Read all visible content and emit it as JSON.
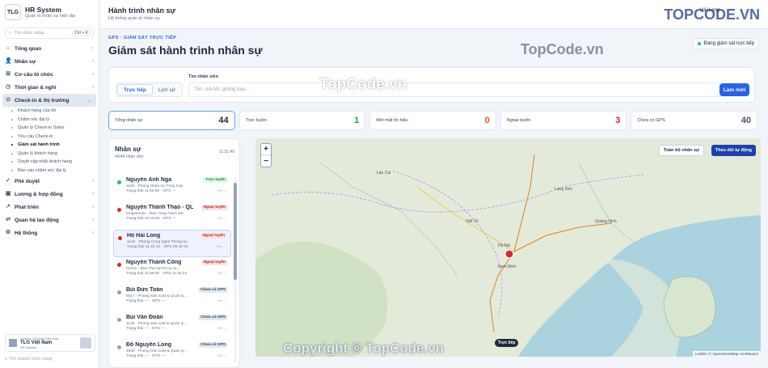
{
  "brand": {
    "logo": "TLG",
    "name": "HR System",
    "sub": "Quản trị nhân sự hiện đại"
  },
  "sidebar": {
    "search_placeholder": "Tìm chức năng...",
    "search_shortcut": "Ctrl + K",
    "items": [
      {
        "label": "Tổng quan",
        "icon": "home-icon"
      },
      {
        "label": "Nhân sự",
        "icon": "users-icon"
      },
      {
        "label": "Cơ cấu tổ chức",
        "icon": "org-icon"
      },
      {
        "label": "Thời gian & nghỉ",
        "icon": "clock-icon"
      },
      {
        "label": "Check-in & thị trường",
        "icon": "pin-icon",
        "expanded": true
      }
    ],
    "subitems": [
      "Khách hàng của tôi",
      "Chăm sóc đại lý",
      "Quản lý Check-in Sales",
      "Yêu cầu Check-in",
      "Giám sát hành trình",
      "Quản lý khách hàng",
      "Duyệt cập nhật khách hàng",
      "Báo cáo chăm sóc đại lý"
    ],
    "active_sub": "Giám sát hành trình",
    "items_after": [
      {
        "label": "Phê duyệt",
        "icon": "check-icon"
      },
      {
        "label": "Lương & hợp đồng",
        "icon": "wallet-icon"
      },
      {
        "label": "Phát triển",
        "icon": "growth-icon"
      },
      {
        "label": "Quan hệ lao động",
        "icon": "handshake-icon"
      },
      {
        "label": "Hệ thống",
        "icon": "gear-icon"
      }
    ],
    "company": {
      "line1": "Công ty Cổ phần Sản xuất",
      "line2": "TLG Việt Nam",
      "line3": "HR System"
    },
    "bottom_search": "Tìm nhanh chức năng"
  },
  "topbar": {
    "title": "Hành trình nhân sự",
    "subtitle": "Hệ thống quản trị nhân sự",
    "user": "Hải Long"
  },
  "page": {
    "eyebrow": "GPS · GIÁM SÁT TRỰC TIẾP",
    "title": "Giám sát hành trình nhân sự",
    "live_status": "Đang giám sát trực tiếp"
  },
  "filter": {
    "tabs": [
      "Trực tiếp",
      "Lịch sử"
    ],
    "active_tab": "Trực tiếp",
    "search_label": "Tìm nhân viên",
    "search_placeholder": "Tên, mã NV, phòng ban...",
    "refresh_label": "Làm mới"
  },
  "stats": [
    {
      "label": "Tổng nhân sự",
      "value": "44",
      "color": "#1e293b"
    },
    {
      "label": "Trực tuyến",
      "value": "1",
      "color": "#16a34a"
    },
    {
      "label": "Mới mất tín hiệu",
      "value": "0",
      "color": "#ea580c"
    },
    {
      "label": "Ngoại tuyến",
      "value": "3",
      "color": "#dc2626"
    },
    {
      "label": "Chưa có GPS",
      "value": "40",
      "color": "#475569"
    }
  ],
  "list": {
    "title": "Nhân sự",
    "count": "44/44 nhân viên",
    "time": "11:51:40",
    "employees": [
      {
        "name": "Nguyễn Anh Nga",
        "meta": "1156 · Phòng Nhân sự Tổng hợp",
        "status_line": "Trạng thái 11:50:59 · GPS —",
        "badge": "Trực tuyến",
        "status": "online",
        "src": "Pin —"
      },
      {
        "name": "Nguyễn Thành Thạo - QL",
        "meta": "tongiamdoc · Ban Tổng Giám đốc",
        "status_line": "Trạng thái 10:16:26 · GPS —",
        "badge": "Ngoại tuyến",
        "status": "offline",
        "src": "Pin —"
      },
      {
        "name": "Hồ Hải Long",
        "meta": "1142 · Phòng Công nghệ Thông tin",
        "status_line": "Trạng thái 11:42:12 · GPS 09:40:16",
        "badge": "Ngoại tuyến",
        "status": "offline",
        "src": "Pin —"
      },
      {
        "name": "Nguyễn Thành Công",
        "meta": "01001 · Ban Thư ký/Trợ lý ca...",
        "status_line": "Trạng thái 11:55:02 · GPS 11:34:44",
        "badge": "Ngoại tuyến",
        "status": "offline",
        "src": "Pin —"
      },
      {
        "name": "Bùi Đức Toàn",
        "meta": "5017 · Phòng Sản xuất & Quản lý ...",
        "status_line": "Trạng thái — · GPS —",
        "badge": "Chưa có GPS",
        "status": "nogps",
        "src": "Pin —"
      },
      {
        "name": "Bùi Văn Đoàn",
        "meta": "1135 · Phòng Sản xuất & Quản lý ...",
        "status_line": "Trạng thái — · GPS —",
        "badge": "Chưa có GPS",
        "status": "nogps",
        "src": "Pin —"
      },
      {
        "name": "Đỗ Nguyên Long",
        "meta": "4600 · Phòng Sản xuất & Quản lý ...",
        "status_line": "Trạng thái — · GPS —",
        "badge": "Chưa có GPS",
        "status": "nogps",
        "src": "Pin —"
      }
    ]
  },
  "map": {
    "btn_all": "Toàn bộ nhân sự",
    "btn_follow": "Theo dõi tự động",
    "tag": "Trực tiếp",
    "attribution": "Leaflet | © OpenStreetMap contributors",
    "labels": [
      "Hà Nội",
      "Nam Định",
      "Việt Trì",
      "Lào Cai",
      "Lạng Sơn",
      "Quảng Ninh"
    ]
  },
  "watermarks": {
    "logo": "TOPCODE.VN",
    "mid": "TopCode.vn",
    "bottom": "Copyright © TopCode.vn"
  },
  "colors": {
    "accent": "#2563eb",
    "online": "#22c55e",
    "offline": "#dc2626",
    "nogps": "#94a3b8"
  }
}
